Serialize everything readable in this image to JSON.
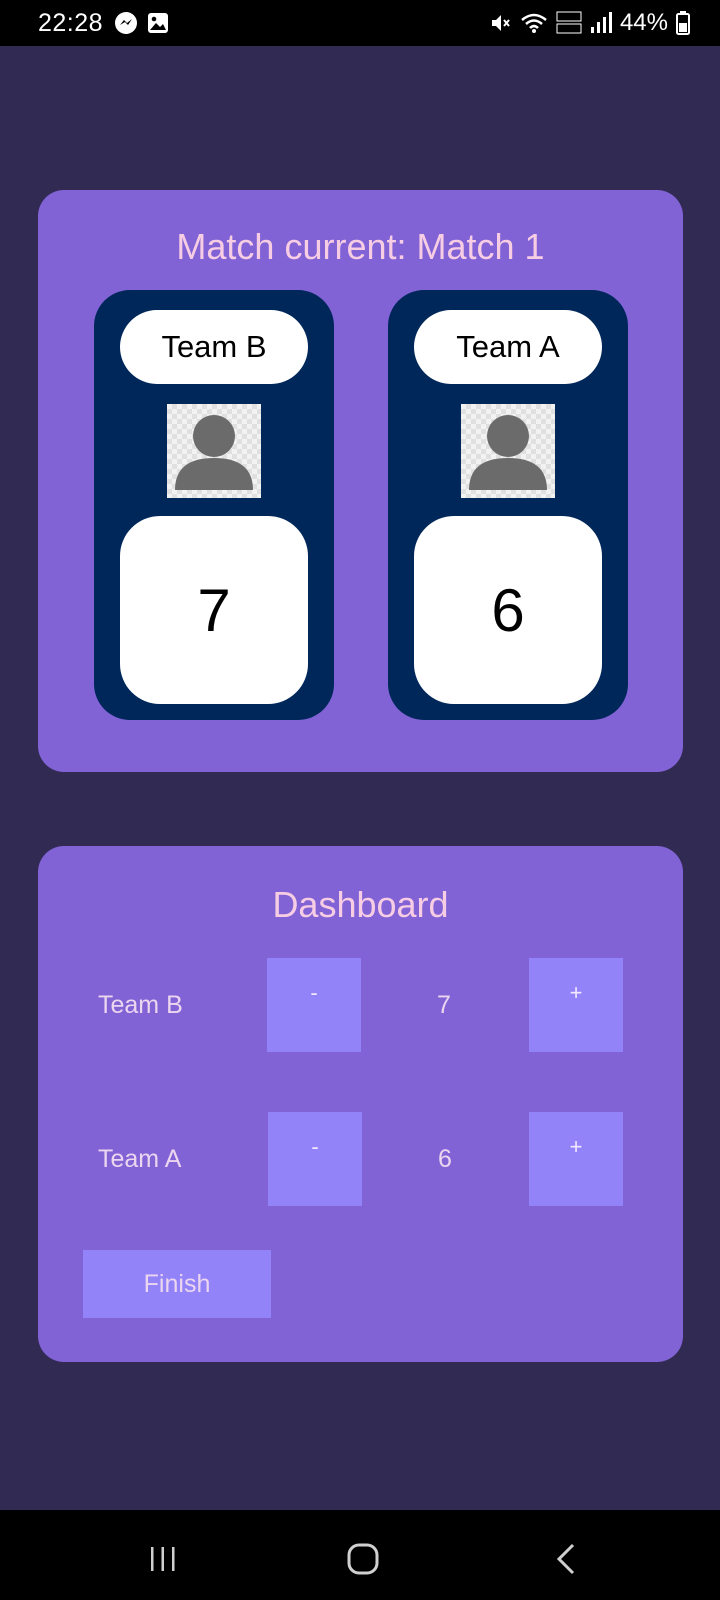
{
  "status_bar": {
    "time": "22:28",
    "battery": "44%",
    "icons": [
      "messenger-icon",
      "gallery-icon",
      "mute-icon",
      "wifi-icon",
      "volte-lte-icon",
      "signal-icon",
      "battery-icon"
    ]
  },
  "match": {
    "title": "Match current: Match 1",
    "teams": [
      {
        "name": "Team B",
        "score": "7"
      },
      {
        "name": "Team A",
        "score": "6"
      }
    ]
  },
  "dashboard": {
    "title": "Dashboard",
    "rows": [
      {
        "team": "Team B",
        "minus": "-",
        "value": "7",
        "plus": "+"
      },
      {
        "team": "Team A",
        "minus": "-",
        "value": "6",
        "plus": "+"
      }
    ],
    "finish_label": "Finish"
  },
  "nav_bar": {
    "icons": [
      "recent-apps-icon",
      "home-icon",
      "back-icon"
    ]
  },
  "colors": {
    "background": "#312a52",
    "card": "#8163d6",
    "team_panel": "#00275a",
    "button": "#9283f9",
    "title_text": "#f7cde4"
  }
}
